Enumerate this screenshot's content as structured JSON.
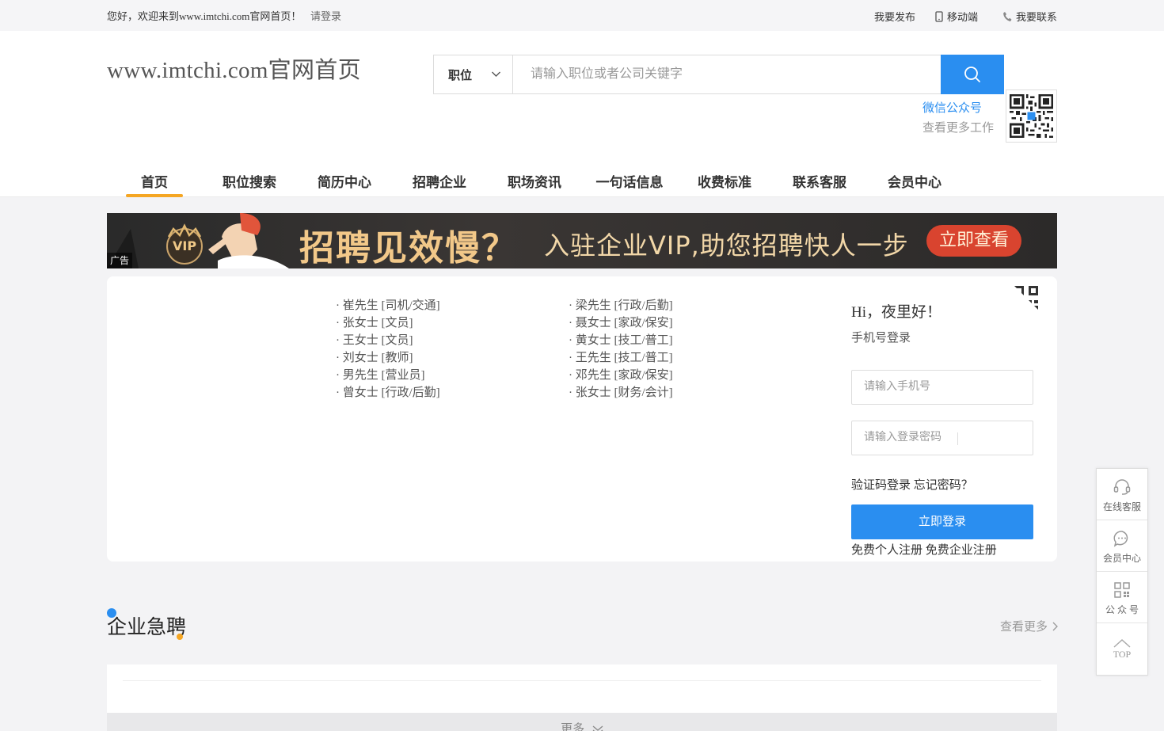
{
  "topbar": {
    "welcome": "您好，欢迎来到www.imtchi.com官网首页！",
    "login": "请登录",
    "publish": "我要发布",
    "mobile": "移动端",
    "contact": "我要联系"
  },
  "header": {
    "logo": "www.imtchi.com官网首页",
    "search_type": "职位",
    "search_placeholder": "请输入职位或者公司关键字",
    "wechat_label": "微信公众号",
    "wechat_sub": "查看更多工作"
  },
  "nav": [
    {
      "label": "首页",
      "active": true
    },
    {
      "label": "职位搜索"
    },
    {
      "label": "简历中心"
    },
    {
      "label": "招聘企业"
    },
    {
      "label": "职场资讯"
    },
    {
      "label": "一句话信息"
    },
    {
      "label": "收费标准"
    },
    {
      "label": "联系客服"
    },
    {
      "label": "会员中心"
    }
  ],
  "banner": {
    "ad_tag": "广告",
    "vip": "VIP",
    "headline": "招聘见效慢？",
    "sub": "入驻企业VIP,助您招聘快人一步",
    "button": "立即查看"
  },
  "talents_left": [
    "· 崔先生 [司机/交通]",
    "· 张女士 [文员]",
    "· 王女士 [文员]",
    "· 刘女士 [教师]",
    "· 男先生 [营业员]",
    "· 曾女士 [行政/后勤]"
  ],
  "talents_right": [
    "· 梁先生 [行政/后勤]",
    "· 聂女士 [家政/保安]",
    "· 黄女士 [技工/普工]",
    "· 王先生 [技工/普工]",
    "· 邓先生 [家政/保安]",
    "· 张女士 [财务/会计]"
  ],
  "login": {
    "greeting": "Hi，夜里好！",
    "mode": "手机号登录",
    "phone_placeholder": "请输入手机号",
    "password_placeholder": "请输入登录密码",
    "sms_login": "验证码登录",
    "forgot": "忘记密码？",
    "submit": "立即登录",
    "reg_personal": "免费个人注册",
    "reg_company": "免费企业注册"
  },
  "section": {
    "title": "企业急聘",
    "more": "查看更多",
    "load_more": "更多"
  },
  "float": [
    {
      "label": "在线客服",
      "icon": "headset-icon"
    },
    {
      "label": "会员中心",
      "icon": "chat-icon"
    },
    {
      "label": "公 众 号",
      "icon": "qrcode-icon"
    },
    {
      "label": "TOP",
      "icon": "arrow-up-icon"
    }
  ]
}
